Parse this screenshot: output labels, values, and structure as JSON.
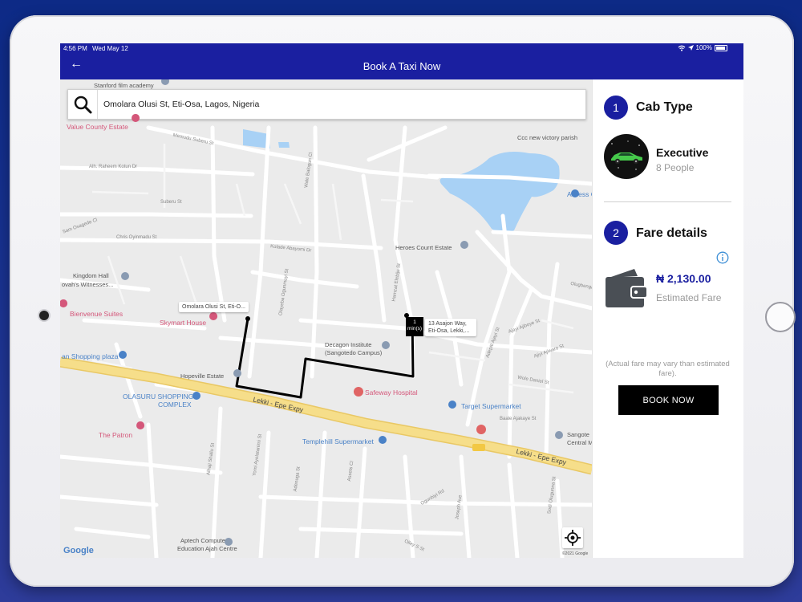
{
  "status_bar": {
    "time": "4:56 PM",
    "date": "Wed May 12",
    "battery": "100%"
  },
  "header": {
    "back_icon": "arrow-left-icon",
    "title": "Book A Taxi Now"
  },
  "search": {
    "value": "Omolara Olusi St, Eti-Osa, Lagos, Nigeria",
    "icon": "search-icon"
  },
  "map": {
    "places": {
      "stanford": "Stanford film academy",
      "value_county": "Value County Estate",
      "ccc": "Ccc new victory parish",
      "access": "Access C",
      "heroes": "Heroes Courrt Estate",
      "kingdom_hall_1": "Kingdom Hall",
      "kingdom_hall_2": "ovah's Witnesses...",
      "bienvenue": "Bienvenue Suites",
      "skymart": "Skymart House",
      "decagon_1": "Decagon Institute",
      "decagon_2": "(Sangotedo Campus)",
      "shopping_plaza": "an Shopping plaza",
      "hopeville": "Hopeville Estate",
      "safeway": "Safeway Hospital",
      "olasuru_1": "OLASURU SHOPPING",
      "olasuru_2": "COMPLEX",
      "target": "Target Supermarket",
      "patron": "The Patron",
      "templehill": "Templehill Supermarket",
      "sango_1": "Sangote",
      "sango_2": "Central M",
      "aptech_1": "Aptech Computer",
      "aptech_2": "Education Ajah Centre"
    },
    "roads": {
      "memudu": "Memudu Suberu St",
      "raheem": "Alh. Raheem Kotun Dr",
      "suberu": "Suberu St",
      "sam": "Sam Osagede Cl",
      "chris": "Chris Oyinmadu St",
      "wale": "Wale Balogun Cl",
      "kolade": "Kolade Abayomi Dr",
      "olayeba": "Olayeba Ogunmuyi St",
      "hamzat": "Hamzat Elebiju St",
      "adepiti": "Adepiti Ajayi St",
      "aiyeku": "Ajayi Ajiboye St",
      "ajayi": "Ajiyi Ajiwaro St",
      "wole": "Wole Daniel St",
      "baale": "Baale Ajakaye St",
      "olugbenga": "Olugbenga St",
      "yomi": "Yomi Ayelatanimi St",
      "alhaji": "Alhaji Shallu St",
      "adenuga": "Adenuga St",
      "assets": "Assets Cl",
      "oguntolu": "Ogunbiyi Rd",
      "joseph": "Joseph Ave",
      "sodi": "Sodi Olugunna St",
      "olley": "Olley S St",
      "lekki_1": "Lekki - Epe Expy",
      "lekki_2": "Lekki - Epe Expy"
    },
    "origin_label": "Omolara Olusi St, Eti-O...",
    "dest_label_1": "13 Asajon Way,",
    "dest_label_2": "Eti-Osa, Lekki,...",
    "eta_num": "1",
    "eta_unit": "min(s)",
    "google": "Google",
    "copyright": "©2021 Google",
    "locate_icon": "target-icon"
  },
  "panel": {
    "cab_step": "1",
    "cab_heading": "Cab Type",
    "cab_name": "Executive",
    "cab_capacity": "8 People",
    "fare_step": "2",
    "fare_heading": "Fare details",
    "fare_amount": "₦ 2,130.00",
    "fare_label": "Estimated Fare",
    "note": "(Actual fare may vary than estimated fare).",
    "book_label": "BOOK NOW"
  },
  "colors": {
    "primary": "#1a1fa0",
    "map_bg": "#ebebeb",
    "expressway": "#f6de8a",
    "water": "#a8d1f5",
    "button": "#000000"
  }
}
